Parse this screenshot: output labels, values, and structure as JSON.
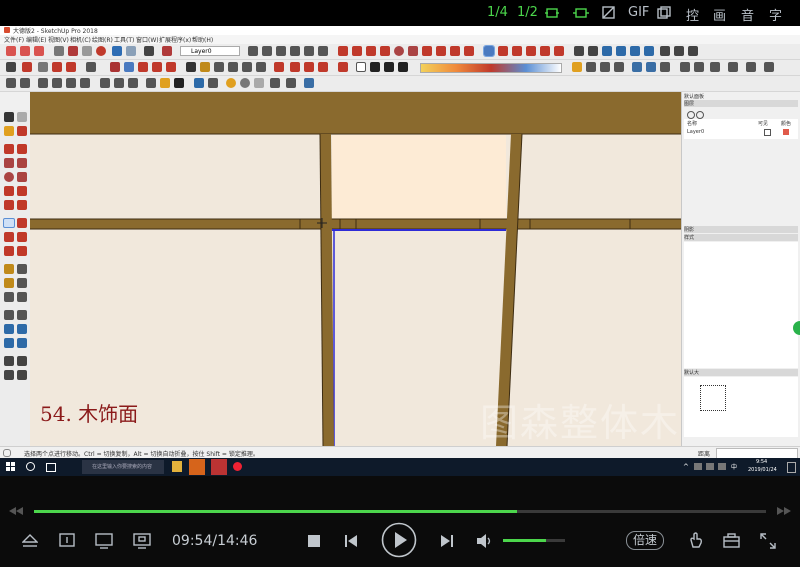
{
  "player_top": {
    "page_a": "1/4",
    "page_b": "1/2",
    "gif": "GIF",
    "label_control": "控",
    "label_picture": "画",
    "label_sound": "音",
    "label_subtitle": "字"
  },
  "app": {
    "title": "大德版2 - SketchUp Pro 2018",
    "menu": [
      "文件(F)",
      "编辑(E)",
      "视图(V)",
      "相机(C)",
      "绘图(R)",
      "工具(T)",
      "窗口(W)",
      "扩展程序(x)",
      "帮助(H)"
    ],
    "layer_select": "Layer0",
    "status_text": "选择两个点进行移动。Ctrl = 切换复制，Alt = 切换自动折叠，按住 Shift = 锁定推理。",
    "measure_label": "距离",
    "watermark": "图森整体木作",
    "caption": "54. 木饰面"
  },
  "right_panel": {
    "layers_title": "默认面板",
    "section_layers": "图层",
    "col_name": "名称",
    "col_visible": "可见",
    "col_color": "颜色",
    "layer_row": "Layer0",
    "section_shadow": "阴影",
    "section_styles": "样式",
    "section_instructor": "默认大"
  },
  "taskbar": {
    "search_placeholder": "在这里输入你要搜索的内容",
    "time": "9:54",
    "date": "2019/01/24"
  },
  "player": {
    "time_current": "09:54",
    "time_total": "14:46",
    "time_display": "09:54/14:46",
    "speed_label": "倍速",
    "progress_pct": 0.66,
    "volume_pct": 0.7
  },
  "colors": {
    "wood": "#8a6a2e",
    "wall": "#f1e8dc",
    "highlight_panel": "#fdebd5",
    "accent_green": "#4cd64c",
    "caption_red": "#8b1a1a"
  }
}
